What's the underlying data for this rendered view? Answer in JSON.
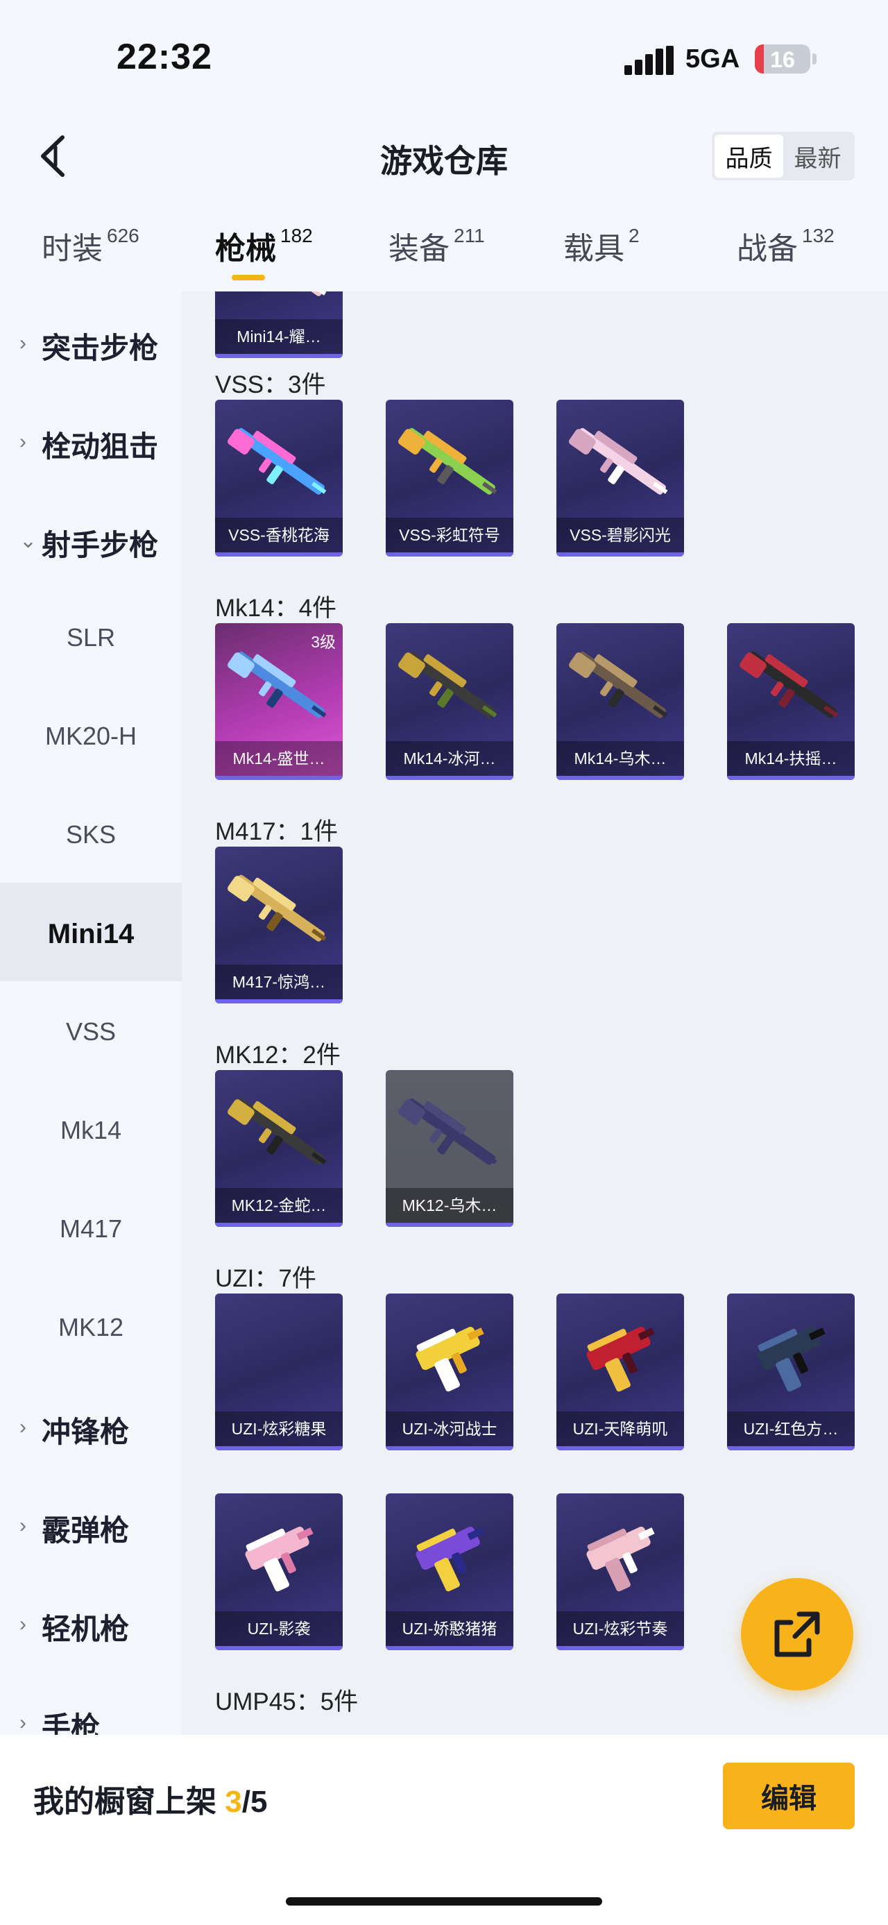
{
  "status_bar": {
    "time": "22:32",
    "network": "5GA",
    "battery": "16",
    "battery_level": 0.16
  },
  "header": {
    "title": "游戏仓库",
    "sort_options": [
      "品质",
      "最新"
    ],
    "sort_active": "品质"
  },
  "tabs": [
    {
      "label": "时装",
      "count": "626"
    },
    {
      "label": "枪械",
      "count": "182",
      "active": true
    },
    {
      "label": "装备",
      "count": "211"
    },
    {
      "label": "载具",
      "count": "2"
    },
    {
      "label": "战备",
      "count": "132"
    }
  ],
  "sidebar": [
    {
      "label": "突击步枪",
      "type": "category",
      "chevron": "›"
    },
    {
      "label": "栓动狙击",
      "type": "category",
      "chevron": "›"
    },
    {
      "label": "射手步枪",
      "type": "category",
      "chevron": "⌄"
    },
    {
      "label": "SLR",
      "type": "sub"
    },
    {
      "label": "MK20-H",
      "type": "sub"
    },
    {
      "label": "SKS",
      "type": "sub"
    },
    {
      "label": "Mini14",
      "type": "sub",
      "selected": true
    },
    {
      "label": "VSS",
      "type": "sub"
    },
    {
      "label": "Mk14",
      "type": "sub"
    },
    {
      "label": "M417",
      "type": "sub"
    },
    {
      "label": "MK12",
      "type": "sub"
    },
    {
      "label": "冲锋枪",
      "type": "category",
      "chevron": "›"
    },
    {
      "label": "霰弹枪",
      "type": "category",
      "chevron": "›"
    },
    {
      "label": "轻机枪",
      "type": "category",
      "chevron": "›"
    },
    {
      "label": "手枪",
      "type": "category",
      "chevron": "›"
    }
  ],
  "sections": [
    {
      "title": "",
      "items": [
        {
          "name": "Mini14-耀…"
        }
      ]
    },
    {
      "title": "VSS：3件",
      "items": [
        {
          "name": "VSS-香桃花海"
        },
        {
          "name": "VSS-彩虹符号"
        },
        {
          "name": "VSS-碧影闪光"
        }
      ]
    },
    {
      "title": "Mk14：4件",
      "items": [
        {
          "name": "Mk14-盛世…",
          "level": "3级"
        },
        {
          "name": "Mk14-冰河…"
        },
        {
          "name": "Mk14-乌木…"
        },
        {
          "name": "Mk14-扶摇…"
        }
      ]
    },
    {
      "title": "M417：1件",
      "items": [
        {
          "name": "M417-惊鸿…"
        }
      ]
    },
    {
      "title": "MK12：2件",
      "items": [
        {
          "name": "MK12-金蛇…"
        },
        {
          "name": "MK12-乌木…"
        }
      ]
    },
    {
      "title": "UZI：7件",
      "items": [
        {
          "name": "UZI-炫彩糖果"
        },
        {
          "name": "UZI-冰河战士"
        },
        {
          "name": "UZI-天降萌叽"
        },
        {
          "name": "UZI-红色方…"
        },
        {
          "name": "UZI-影袭"
        },
        {
          "name": "UZI-娇憨猪猪"
        },
        {
          "name": "UZI-炫彩节奏"
        }
      ]
    },
    {
      "title": "UMP45：5件",
      "items": []
    }
  ],
  "bottom_bar": {
    "shelf_label": "我的橱窗上架 ",
    "shelf_current": "3",
    "shelf_total": "/5",
    "edit_label": "编辑"
  },
  "colors": {
    "accent": "#f5b515",
    "card_purple": "#2c2960",
    "card_pink": "#b23cb2",
    "bottom_stripe": "#6f63e6"
  },
  "icons": {
    "back": "chevron-left-icon",
    "fab": "share-export-icon"
  }
}
